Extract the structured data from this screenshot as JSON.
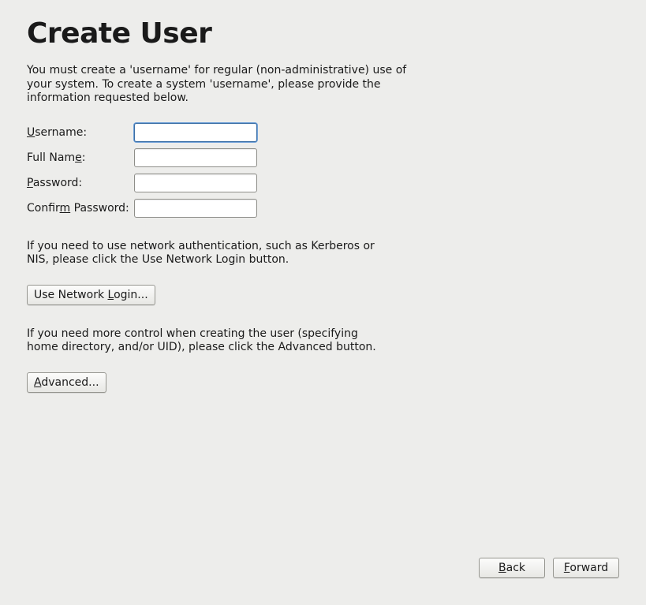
{
  "title": "Create User",
  "intro": "You must create a 'username' for regular (non-administrative) use of your system.  To create a system 'username', please provide the information requested below.",
  "fields": {
    "username": {
      "label_pre": "",
      "label_u": "U",
      "label_post": "sername:",
      "value": ""
    },
    "fullname": {
      "label_pre": "Full Nam",
      "label_u": "e",
      "label_post": ":",
      "value": ""
    },
    "password": {
      "label_pre": "",
      "label_u": "P",
      "label_post": "assword:",
      "value": ""
    },
    "confirm": {
      "label_pre": "Confir",
      "label_u": "m",
      "label_post": " Password:",
      "value": ""
    }
  },
  "network_text": "If you need to use network authentication, such as Kerberos or NIS, please click the Use Network Login button.",
  "network_btn": {
    "pre": "Use Network ",
    "u": "L",
    "post": "ogin..."
  },
  "advanced_text": "If you need more control when creating the user (specifying home directory, and/or UID), please click the Advanced button.",
  "advanced_btn": {
    "pre": "",
    "u": "A",
    "post": "dvanced..."
  },
  "nav": {
    "back": {
      "pre": "",
      "u": "B",
      "post": "ack"
    },
    "forward": {
      "pre": "",
      "u": "F",
      "post": "orward"
    }
  }
}
